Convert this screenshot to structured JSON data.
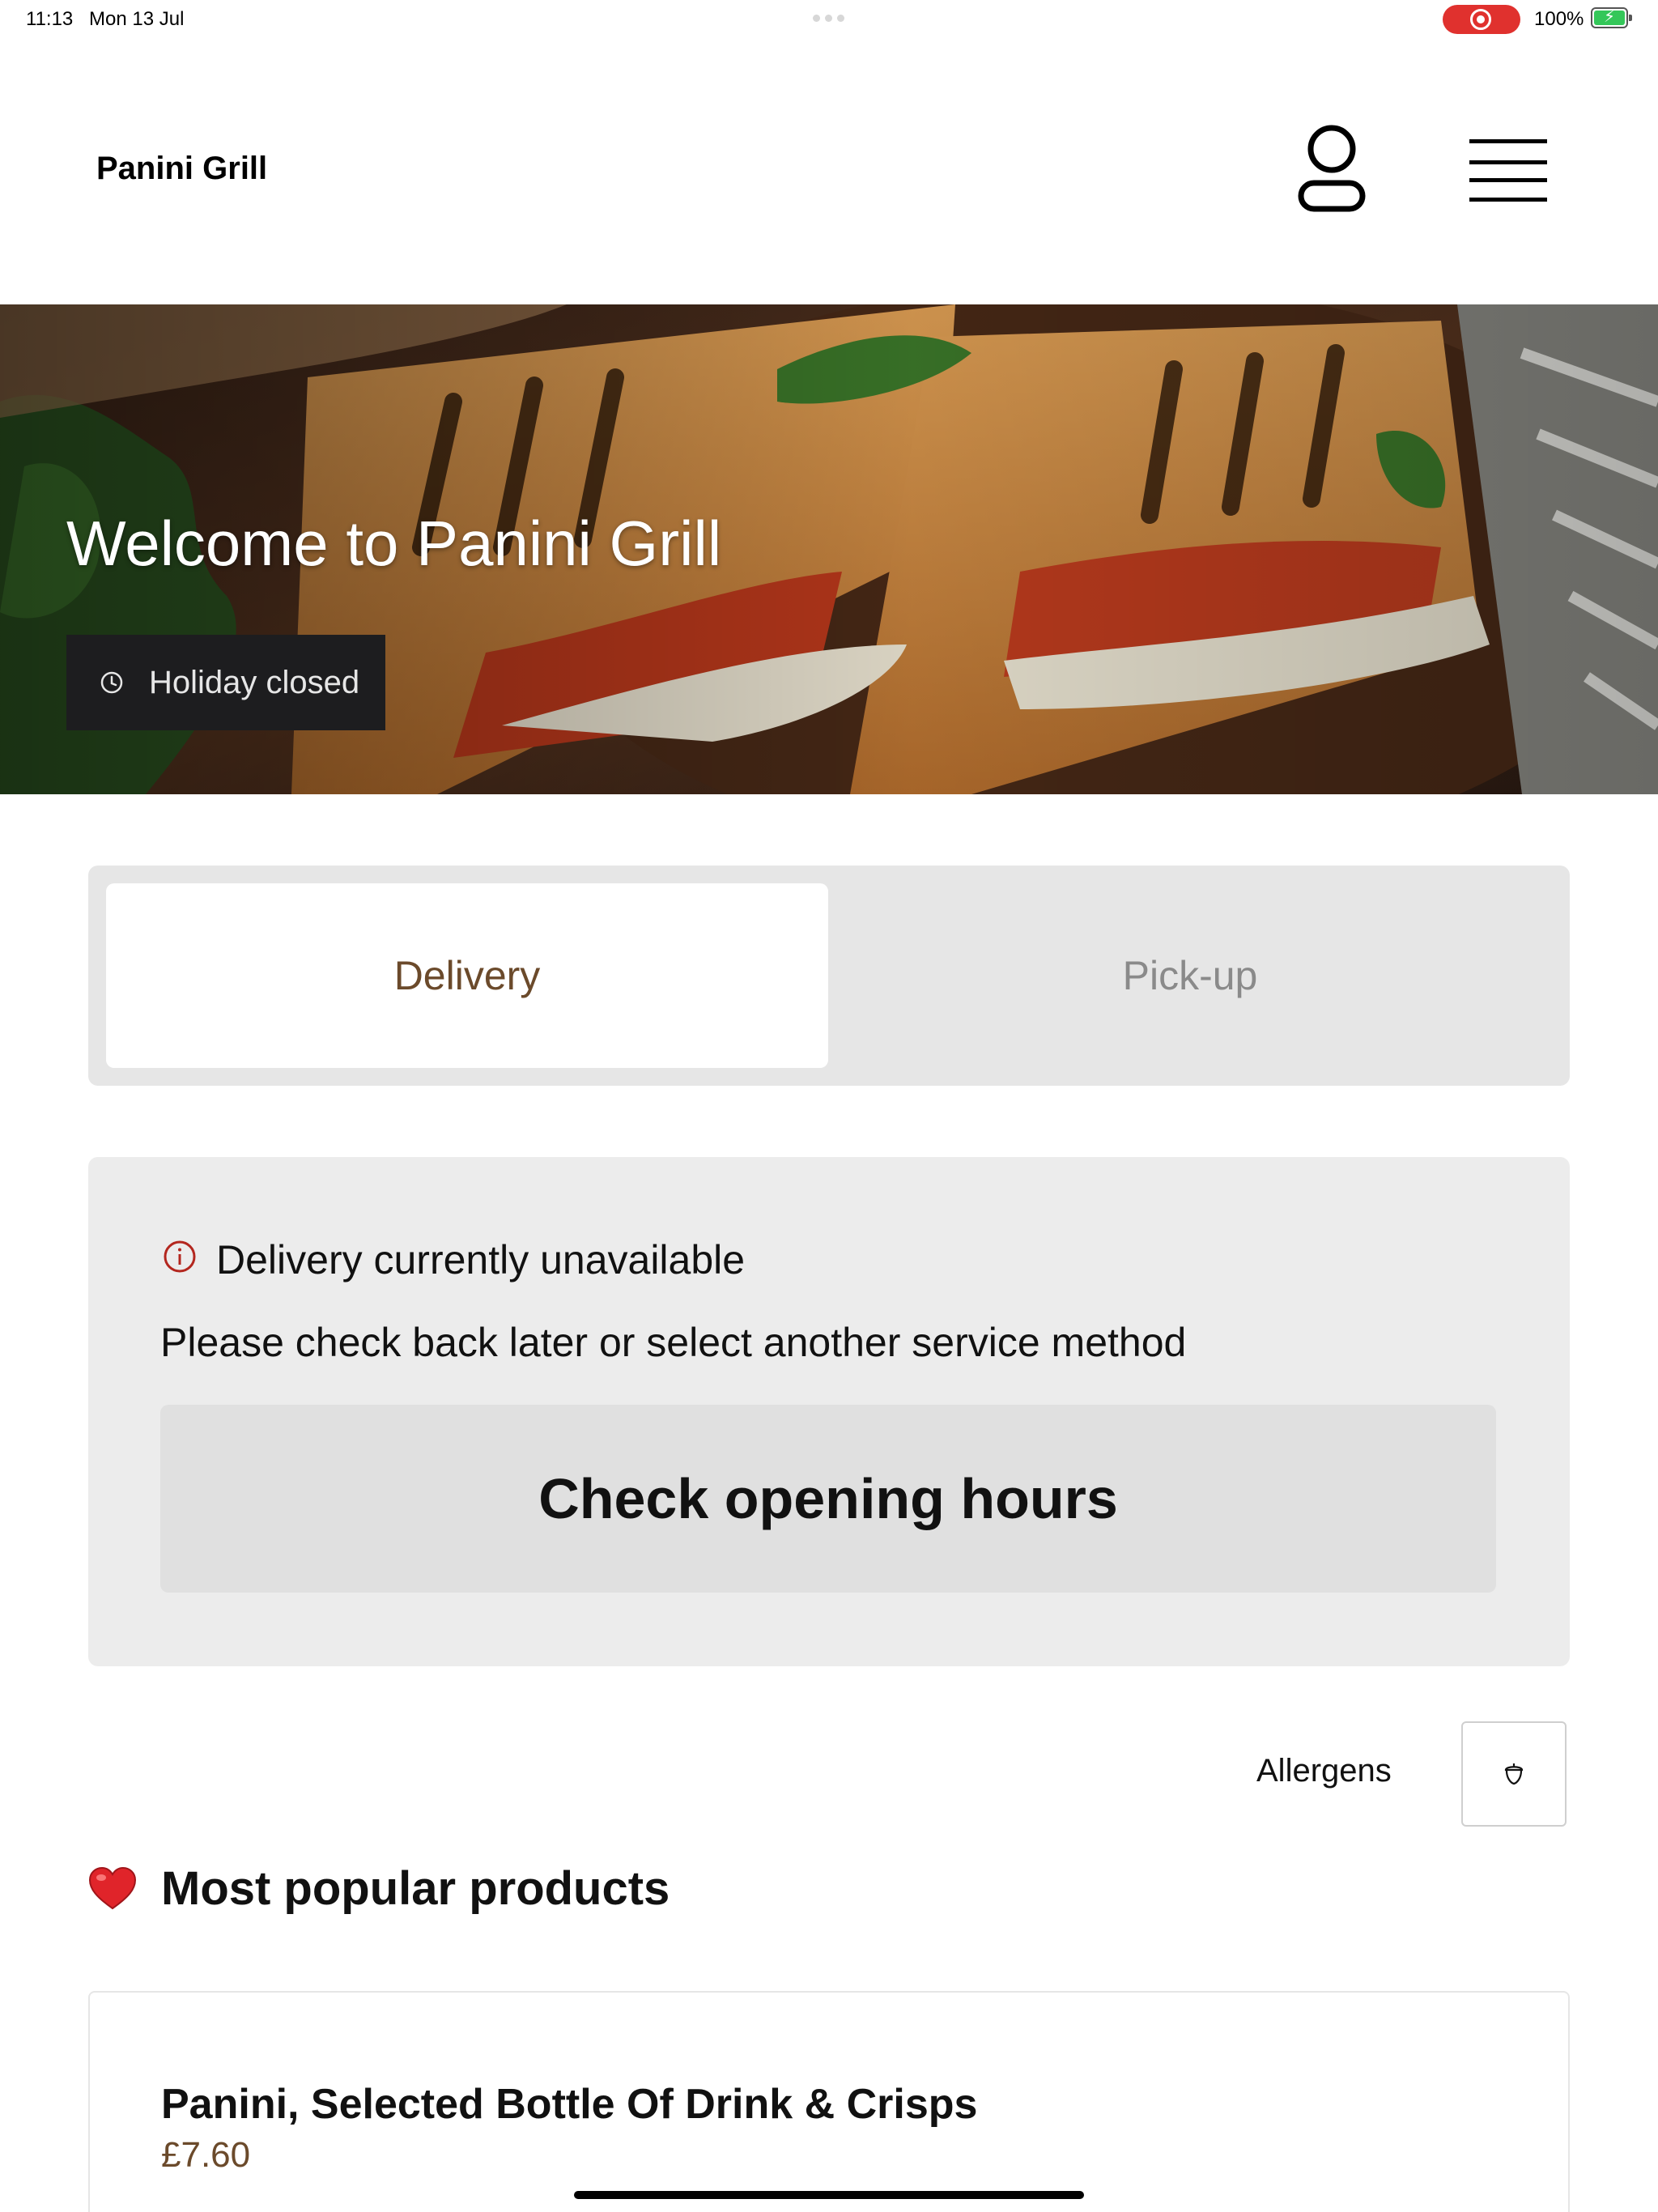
{
  "status_bar": {
    "time": "11:13",
    "date": "Mon 13 Jul",
    "battery": "100%",
    "record_color": "#e0312e"
  },
  "header": {
    "brand": "Panini Grill",
    "profile_icon": "user-icon",
    "menu_icon": "hamburger-menu-icon"
  },
  "hero": {
    "title": "Welcome to Panini Grill",
    "hours_status": "Holiday closed",
    "hours_icon": "clock-icon"
  },
  "service_tabs": {
    "items": [
      {
        "label": "Delivery",
        "selected": true
      },
      {
        "label": "Pick-up",
        "selected": false
      }
    ],
    "accent_color": "#6b4a2b"
  },
  "notice": {
    "icon": "info-icon",
    "title": "Delivery currently unavailable",
    "description": "Please check back later or select another service method",
    "button_label": "Check opening hours"
  },
  "allergens": {
    "label": "Allergens",
    "icon": "acorn-icon"
  },
  "popular": {
    "icon": "heart-icon",
    "title": "Most popular products",
    "products": [
      {
        "name": "Panini, Selected Bottle Of Drink & Crisps",
        "price": "£7.60"
      }
    ]
  }
}
